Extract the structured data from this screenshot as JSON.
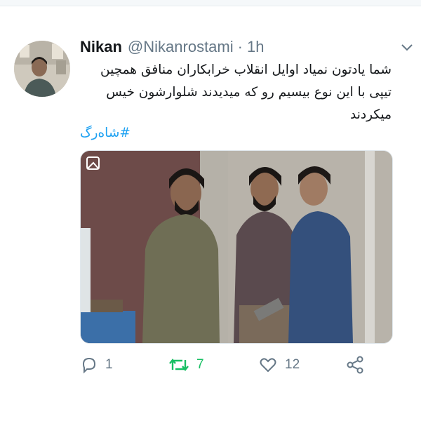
{
  "tweet": {
    "author_name": "Nikan",
    "author_handle": "@Nikanrostami",
    "separator": "·",
    "timestamp": "1h",
    "text_lines": [
      "شما یادتون نمیاد اوایل انقلاب خرابکاران منافق همچین",
      "تیپی با این نوع بیسیم رو که میدیدند شلوارشون خیس",
      "میکردند"
    ],
    "hashtag": "#شاه‌رگ",
    "media": {
      "type": "photo",
      "badge": "gif-icon"
    },
    "actions": {
      "reply": {
        "icon": "reply-icon",
        "count": "1"
      },
      "retweet": {
        "icon": "retweet-icon",
        "count": "7",
        "color": "#17bf63"
      },
      "like": {
        "icon": "heart-icon",
        "count": "12"
      },
      "share": {
        "icon": "share-icon"
      }
    }
  },
  "colors": {
    "text": "#14171a",
    "muted": "#657786",
    "link": "#1da1f2",
    "retweet": "#17bf63"
  }
}
